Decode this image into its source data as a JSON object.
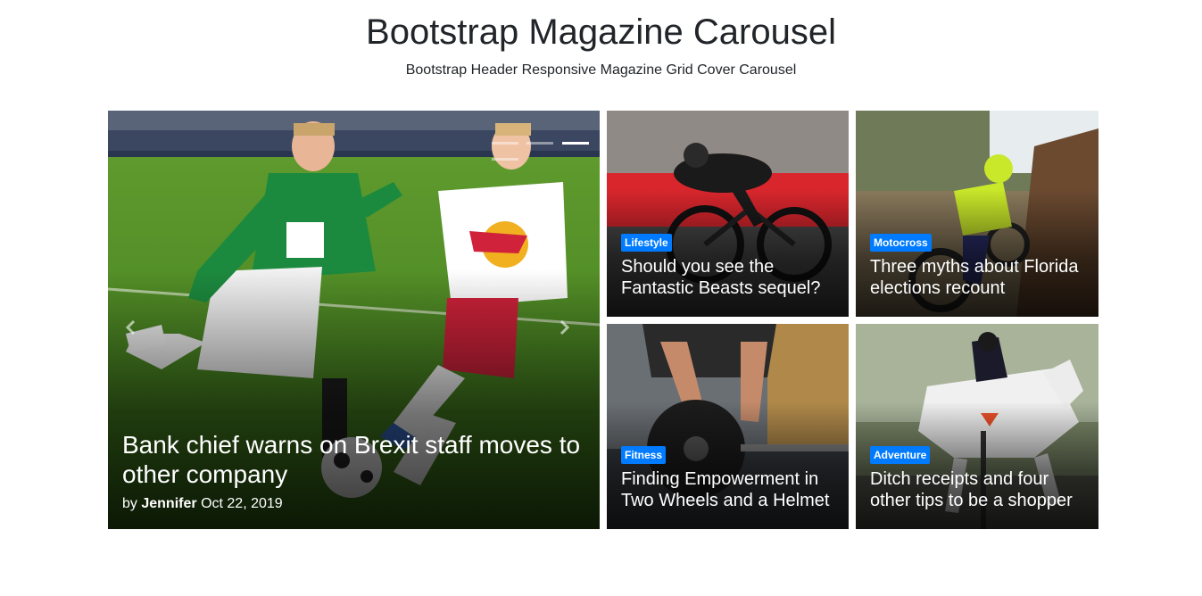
{
  "header": {
    "title": "Bootstrap Magazine Carousel",
    "subtitle": "Bootstrap Header Responsive Magazine Grid Cover Carousel"
  },
  "main_story": {
    "title": "Bank chief warns on Brexit staff moves to other company",
    "by_label": "by",
    "author": "Jennifer",
    "date": "Oct 22, 2019",
    "image": "soccer-players-photo"
  },
  "carousel": {
    "indicator_count": 4,
    "active_indicator": 2,
    "prev_icon": "chevron-left-icon",
    "next_icon": "chevron-right-icon"
  },
  "stories": [
    {
      "category": "Lifestyle",
      "title": "Should you see the Fantastic Beasts sequel?",
      "image": "cyclist-photo"
    },
    {
      "category": "Motocross",
      "title": "Three myths about Florida elections recount",
      "image": "motocross-rider-photo"
    },
    {
      "category": "Fitness",
      "title": "Finding Empowerment in Two Wheels and a Helmet",
      "image": "weightlifting-photo"
    },
    {
      "category": "Adventure",
      "title": "Ditch receipts and four other tips to be a shopper",
      "image": "show-jumping-horse-photo"
    }
  ],
  "colors": {
    "badge": "#007bff",
    "text_dark": "#212529",
    "text_light": "#ffffff"
  }
}
